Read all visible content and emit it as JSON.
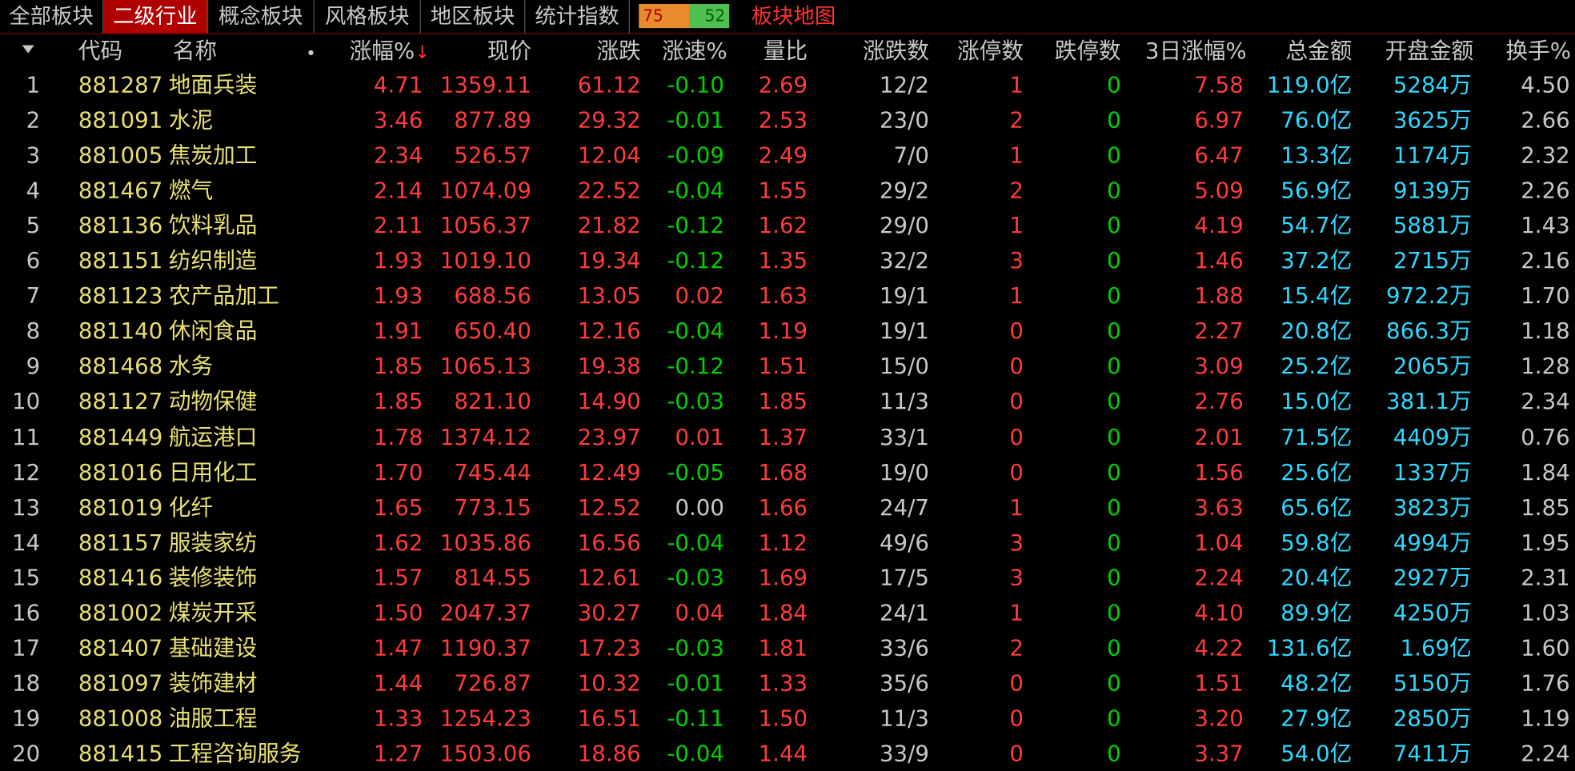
{
  "tabs": [
    {
      "label": "全部板块",
      "active": false
    },
    {
      "label": "二级行业",
      "active": true
    },
    {
      "label": "概念板块",
      "active": false
    },
    {
      "label": "风格板块",
      "active": false
    },
    {
      "label": "地区板块",
      "active": false
    },
    {
      "label": "统计指数",
      "active": false
    }
  ],
  "counters": {
    "up": "75",
    "down": "52"
  },
  "map_link": "板块地图",
  "headers": {
    "code": "代码",
    "name": "名称",
    "pct": "涨幅%",
    "price": "现价",
    "chg": "涨跌",
    "speed": "涨速%",
    "vol_ratio": "量比",
    "up_down": "涨跌数",
    "limit_up": "涨停数",
    "limit_down": "跌停数",
    "pct3d": "3日涨幅%",
    "total": "总金额",
    "open_amt": "开盘金额",
    "turnover": "换手%"
  },
  "colors": {
    "up": "#ff3b3b",
    "down": "#00d000",
    "neutral": "#c8c8c8",
    "amount": "#30d8ff",
    "name": "#e8e070"
  },
  "rows": [
    {
      "idx": "1",
      "code": "881287",
      "name": "地面兵装",
      "pct": "4.71",
      "price": "1359.11",
      "chg": "61.12",
      "speed": "-0.10",
      "vol_ratio": "2.69",
      "up_down": "12/2",
      "limit_up": "1",
      "limit_down": "0",
      "pct3d": "7.58",
      "total": "119.0亿",
      "open_amt": "5284万",
      "turnover": "4.50"
    },
    {
      "idx": "2",
      "code": "881091",
      "name": "水泥",
      "pct": "3.46",
      "price": "877.89",
      "chg": "29.32",
      "speed": "-0.01",
      "vol_ratio": "2.53",
      "up_down": "23/0",
      "limit_up": "2",
      "limit_down": "0",
      "pct3d": "6.97",
      "total": "76.0亿",
      "open_amt": "3625万",
      "turnover": "2.66"
    },
    {
      "idx": "3",
      "code": "881005",
      "name": "焦炭加工",
      "pct": "2.34",
      "price": "526.57",
      "chg": "12.04",
      "speed": "-0.09",
      "vol_ratio": "2.49",
      "up_down": "7/0",
      "limit_up": "1",
      "limit_down": "0",
      "pct3d": "6.47",
      "total": "13.3亿",
      "open_amt": "1174万",
      "turnover": "2.32"
    },
    {
      "idx": "4",
      "code": "881467",
      "name": "燃气",
      "pct": "2.14",
      "price": "1074.09",
      "chg": "22.52",
      "speed": "-0.04",
      "vol_ratio": "1.55",
      "up_down": "29/2",
      "limit_up": "2",
      "limit_down": "0",
      "pct3d": "5.09",
      "total": "56.9亿",
      "open_amt": "9139万",
      "turnover": "2.26"
    },
    {
      "idx": "5",
      "code": "881136",
      "name": "饮料乳品",
      "pct": "2.11",
      "price": "1056.37",
      "chg": "21.82",
      "speed": "-0.12",
      "vol_ratio": "1.62",
      "up_down": "29/0",
      "limit_up": "1",
      "limit_down": "0",
      "pct3d": "4.19",
      "total": "54.7亿",
      "open_amt": "5881万",
      "turnover": "1.43"
    },
    {
      "idx": "6",
      "code": "881151",
      "name": "纺织制造",
      "pct": "1.93",
      "price": "1019.10",
      "chg": "19.34",
      "speed": "-0.12",
      "vol_ratio": "1.35",
      "up_down": "32/2",
      "limit_up": "3",
      "limit_down": "0",
      "pct3d": "1.46",
      "total": "37.2亿",
      "open_amt": "2715万",
      "turnover": "2.16"
    },
    {
      "idx": "7",
      "code": "881123",
      "name": "农产品加工",
      "pct": "1.93",
      "price": "688.56",
      "chg": "13.05",
      "speed": "0.02",
      "vol_ratio": "1.63",
      "up_down": "19/1",
      "limit_up": "1",
      "limit_down": "0",
      "pct3d": "1.88",
      "total": "15.4亿",
      "open_amt": "972.2万",
      "turnover": "1.70"
    },
    {
      "idx": "8",
      "code": "881140",
      "name": "休闲食品",
      "pct": "1.91",
      "price": "650.40",
      "chg": "12.16",
      "speed": "-0.04",
      "vol_ratio": "1.19",
      "up_down": "19/1",
      "limit_up": "0",
      "limit_down": "0",
      "pct3d": "2.27",
      "total": "20.8亿",
      "open_amt": "866.3万",
      "turnover": "1.18"
    },
    {
      "idx": "9",
      "code": "881468",
      "name": "水务",
      "pct": "1.85",
      "price": "1065.13",
      "chg": "19.38",
      "speed": "-0.12",
      "vol_ratio": "1.51",
      "up_down": "15/0",
      "limit_up": "0",
      "limit_down": "0",
      "pct3d": "3.09",
      "total": "25.2亿",
      "open_amt": "2065万",
      "turnover": "1.28"
    },
    {
      "idx": "10",
      "code": "881127",
      "name": "动物保健",
      "pct": "1.85",
      "price": "821.10",
      "chg": "14.90",
      "speed": "-0.03",
      "vol_ratio": "1.85",
      "up_down": "11/3",
      "limit_up": "0",
      "limit_down": "0",
      "pct3d": "2.76",
      "total": "15.0亿",
      "open_amt": "381.1万",
      "turnover": "2.34"
    },
    {
      "idx": "11",
      "code": "881449",
      "name": "航运港口",
      "pct": "1.78",
      "price": "1374.12",
      "chg": "23.97",
      "speed": "0.01",
      "vol_ratio": "1.37",
      "up_down": "33/1",
      "limit_up": "0",
      "limit_down": "0",
      "pct3d": "2.01",
      "total": "71.5亿",
      "open_amt": "4409万",
      "turnover": "0.76"
    },
    {
      "idx": "12",
      "code": "881016",
      "name": "日用化工",
      "pct": "1.70",
      "price": "745.44",
      "chg": "12.49",
      "speed": "-0.05",
      "vol_ratio": "1.68",
      "up_down": "19/0",
      "limit_up": "0",
      "limit_down": "0",
      "pct3d": "1.56",
      "total": "25.6亿",
      "open_amt": "1337万",
      "turnover": "1.84"
    },
    {
      "idx": "13",
      "code": "881019",
      "name": "化纤",
      "pct": "1.65",
      "price": "773.15",
      "chg": "12.52",
      "speed": "0.00",
      "vol_ratio": "1.66",
      "up_down": "24/7",
      "limit_up": "1",
      "limit_down": "0",
      "pct3d": "3.63",
      "total": "65.6亿",
      "open_amt": "3823万",
      "turnover": "1.85"
    },
    {
      "idx": "14",
      "code": "881157",
      "name": "服装家纺",
      "pct": "1.62",
      "price": "1035.86",
      "chg": "16.56",
      "speed": "-0.04",
      "vol_ratio": "1.12",
      "up_down": "49/6",
      "limit_up": "3",
      "limit_down": "0",
      "pct3d": "1.04",
      "total": "59.8亿",
      "open_amt": "4994万",
      "turnover": "1.95"
    },
    {
      "idx": "15",
      "code": "881416",
      "name": "装修装饰",
      "pct": "1.57",
      "price": "814.55",
      "chg": "12.61",
      "speed": "-0.03",
      "vol_ratio": "1.69",
      "up_down": "17/5",
      "limit_up": "3",
      "limit_down": "0",
      "pct3d": "2.24",
      "total": "20.4亿",
      "open_amt": "2927万",
      "turnover": "2.31"
    },
    {
      "idx": "16",
      "code": "881002",
      "name": "煤炭开采",
      "pct": "1.50",
      "price": "2047.37",
      "chg": "30.27",
      "speed": "0.04",
      "vol_ratio": "1.84",
      "up_down": "24/1",
      "limit_up": "1",
      "limit_down": "0",
      "pct3d": "4.10",
      "total": "89.9亿",
      "open_amt": "4250万",
      "turnover": "1.03"
    },
    {
      "idx": "17",
      "code": "881407",
      "name": "基础建设",
      "pct": "1.47",
      "price": "1190.37",
      "chg": "17.23",
      "speed": "-0.03",
      "vol_ratio": "1.81",
      "up_down": "33/6",
      "limit_up": "2",
      "limit_down": "0",
      "pct3d": "4.22",
      "total": "131.6亿",
      "open_amt": "1.69亿",
      "turnover": "1.60"
    },
    {
      "idx": "18",
      "code": "881097",
      "name": "装饰建材",
      "pct": "1.44",
      "price": "726.87",
      "chg": "10.32",
      "speed": "-0.01",
      "vol_ratio": "1.33",
      "up_down": "35/6",
      "limit_up": "0",
      "limit_down": "0",
      "pct3d": "1.51",
      "total": "48.2亿",
      "open_amt": "5150万",
      "turnover": "1.76"
    },
    {
      "idx": "19",
      "code": "881008",
      "name": "油服工程",
      "pct": "1.33",
      "price": "1254.23",
      "chg": "16.51",
      "speed": "-0.11",
      "vol_ratio": "1.50",
      "up_down": "11/3",
      "limit_up": "0",
      "limit_down": "0",
      "pct3d": "3.20",
      "total": "27.9亿",
      "open_amt": "2850万",
      "turnover": "1.19"
    },
    {
      "idx": "20",
      "code": "881415",
      "name": "工程咨询服务",
      "pct": "1.27",
      "price": "1503.06",
      "chg": "18.86",
      "speed": "-0.04",
      "vol_ratio": "1.44",
      "up_down": "33/9",
      "limit_up": "0",
      "limit_down": "0",
      "pct3d": "3.37",
      "total": "54.0亿",
      "open_amt": "7411万",
      "turnover": "2.24"
    }
  ]
}
